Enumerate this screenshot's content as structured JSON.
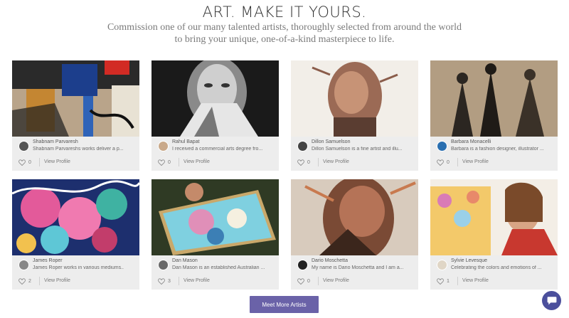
{
  "header": {
    "title": "ART. MAKE IT YOURS.",
    "subtitle": "Commission one of our many talented artists, thoroughly selected from around the world to bring your unique, one-of-a-kind masterpiece to life."
  },
  "artists": [
    {
      "name": "Shabnam Parvaresh",
      "desc": "Shabnam Parvareshs works deliver a p...",
      "likes": "0",
      "profile": "View Profile"
    },
    {
      "name": "Rahul Bapat",
      "desc": "I received a commercial arts degree fro...",
      "likes": "0",
      "profile": "View Profile"
    },
    {
      "name": "Dillon Samuelson",
      "desc": "Dillon Samuelson is a fine artist and illu...",
      "likes": "0",
      "profile": "View Profile"
    },
    {
      "name": "Barbara Monacelli",
      "desc": "Barbara is a fashion designer, illustrator ...",
      "likes": "0",
      "profile": "View Profile"
    },
    {
      "name": "James Roper",
      "desc": "James Roper works in various mediums..",
      "likes": "2",
      "profile": "View Profile"
    },
    {
      "name": "Dan Mason",
      "desc": "Dan Mason is an established Australian ...",
      "likes": "3",
      "profile": "View Profile"
    },
    {
      "name": "Dario Moschetta",
      "desc": "My name is Dario Moschetta and I am a...",
      "likes": "0",
      "profile": "View Profile"
    },
    {
      "name": "Sylvie Levesque",
      "desc": "Celebrating the colors and emotions of ...",
      "likes": "1",
      "profile": "View Profile"
    }
  ],
  "cta": {
    "label": "Meet More Artists"
  },
  "chat": {
    "icon": "chat-bubble-icon"
  },
  "colors": {
    "button": "#6a62a8",
    "chat": "#4b4f9c",
    "card_bg": "#ededed"
  }
}
